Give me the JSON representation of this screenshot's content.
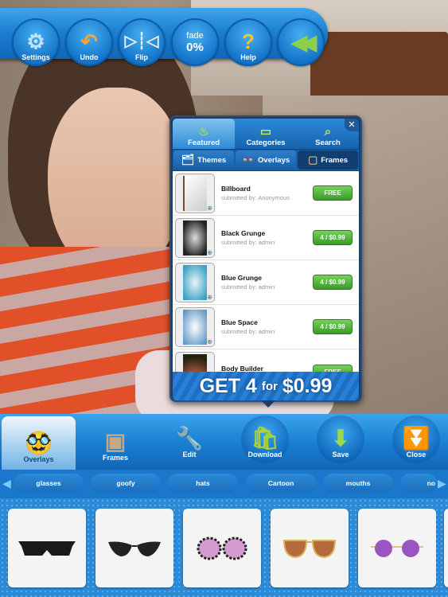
{
  "toolbar": {
    "settings": "Settings",
    "undo": "Undo",
    "flip": "Flip",
    "fade_label": "fade",
    "fade_value": "0%",
    "help": "Help"
  },
  "popup": {
    "tabs": [
      "Featured",
      "Categories",
      "Search"
    ],
    "subtabs": [
      "Themes",
      "Overlays",
      "Frames"
    ],
    "items": [
      {
        "name": "Billboard",
        "submitted": "submitted by: Anonymous",
        "price": "FREE"
      },
      {
        "name": "Black Grunge",
        "submitted": "submitted by: admin",
        "price": "4 / $0.99"
      },
      {
        "name": "Blue Grunge",
        "submitted": "submitted by: admin",
        "price": "4 / $0.99"
      },
      {
        "name": "Blue Space",
        "submitted": "submitted by: admin",
        "price": "4 / $0.99"
      },
      {
        "name": "Body Builder",
        "submitted": "",
        "price": "FREE"
      }
    ],
    "banner": {
      "get": "GET 4",
      "for": "for",
      "price": "$0.99"
    }
  },
  "bottombar": {
    "overlays": "Overlays",
    "frames": "Frames",
    "edit": "Edit",
    "download": "Download",
    "save": "Save",
    "close": "Close"
  },
  "categories": [
    "glasses",
    "goofy",
    "hats",
    "Cartoon",
    "mouths",
    "no"
  ],
  "colors": {
    "toolbar_blue": "#1a7dd0",
    "price_green": "#3b9c2a",
    "active_tab": "#7fc3f2"
  }
}
